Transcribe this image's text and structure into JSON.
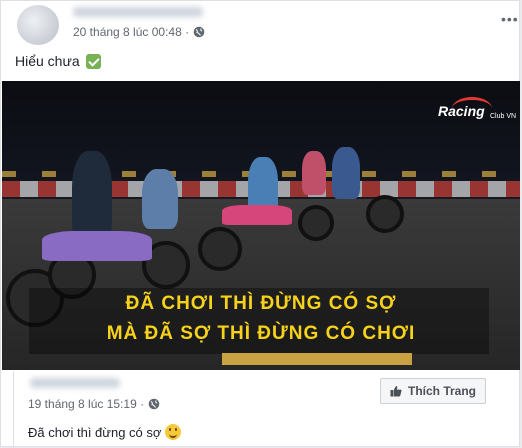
{
  "post": {
    "timestamp": "20 tháng 8 lúc 00:48 ·",
    "privacy_icon": "globe-icon",
    "text": "Hiểu chưa",
    "emoji": "check-mark-icon",
    "more_label": "•••"
  },
  "video": {
    "logo_main": "Racing",
    "logo_sub": "Club VN",
    "subtitle_line1": "ĐÃ CHƠI THÌ ĐỪNG CÓ SỢ",
    "subtitle_line2": "MÀ ĐÃ SỢ THÌ ĐỪNG CÓ CHƠI"
  },
  "shared": {
    "timestamp": "19 tháng 8 lúc 15:19 ·",
    "privacy_icon": "globe-icon",
    "like_page_label": "Thích Trang",
    "caption": "Đã chơi thì đừng có sợ",
    "emoji": "smile-icon"
  },
  "colors": {
    "subtitle": "#f7d21b",
    "logo_accent": "#e53935",
    "check_green": "#77b255"
  }
}
